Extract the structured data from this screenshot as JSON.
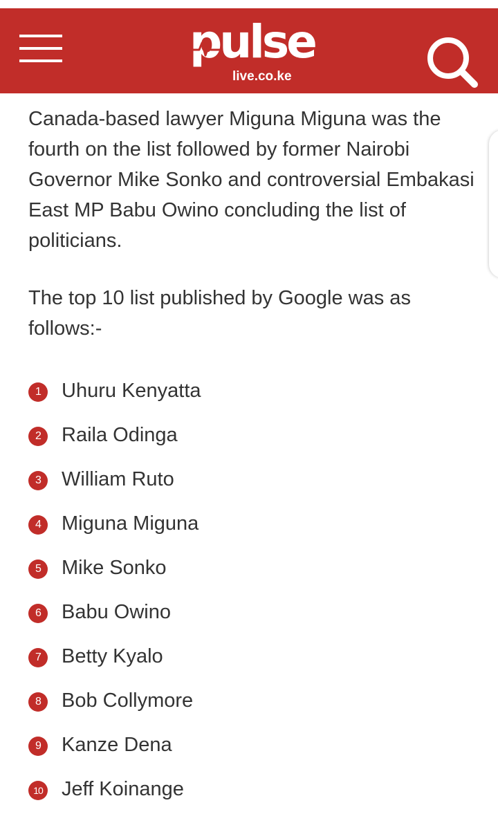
{
  "header": {
    "brand": "pulse",
    "domain": "live.co.ke",
    "menu_icon": "hamburger-menu-icon",
    "search_icon": "search-icon",
    "bg_color": "#c12d29"
  },
  "article": {
    "paragraph1": "Canada-based lawyer Miguna Miguna was the fourth on the list followed by former Nairobi Governor Mike Sonko and controversial Embakasi East MP Babu Owino concluding the list of politicians.",
    "paragraph2": "The top 10 list published by Google was as follows:-",
    "ranking": [
      {
        "num": "1",
        "name": "Uhuru Kenyatta"
      },
      {
        "num": "2",
        "name": "Raila Odinga"
      },
      {
        "num": "3",
        "name": "William Ruto"
      },
      {
        "num": "4",
        "name": "Miguna Miguna"
      },
      {
        "num": "5",
        "name": "Mike Sonko"
      },
      {
        "num": "6",
        "name": "Babu Owino"
      },
      {
        "num": "7",
        "name": "Betty Kyalo"
      },
      {
        "num": "8",
        "name": "Bob Collymore"
      },
      {
        "num": "9",
        "name": "Kanze Dena"
      },
      {
        "num": "10",
        "name": "Jeff Koinange"
      }
    ]
  }
}
